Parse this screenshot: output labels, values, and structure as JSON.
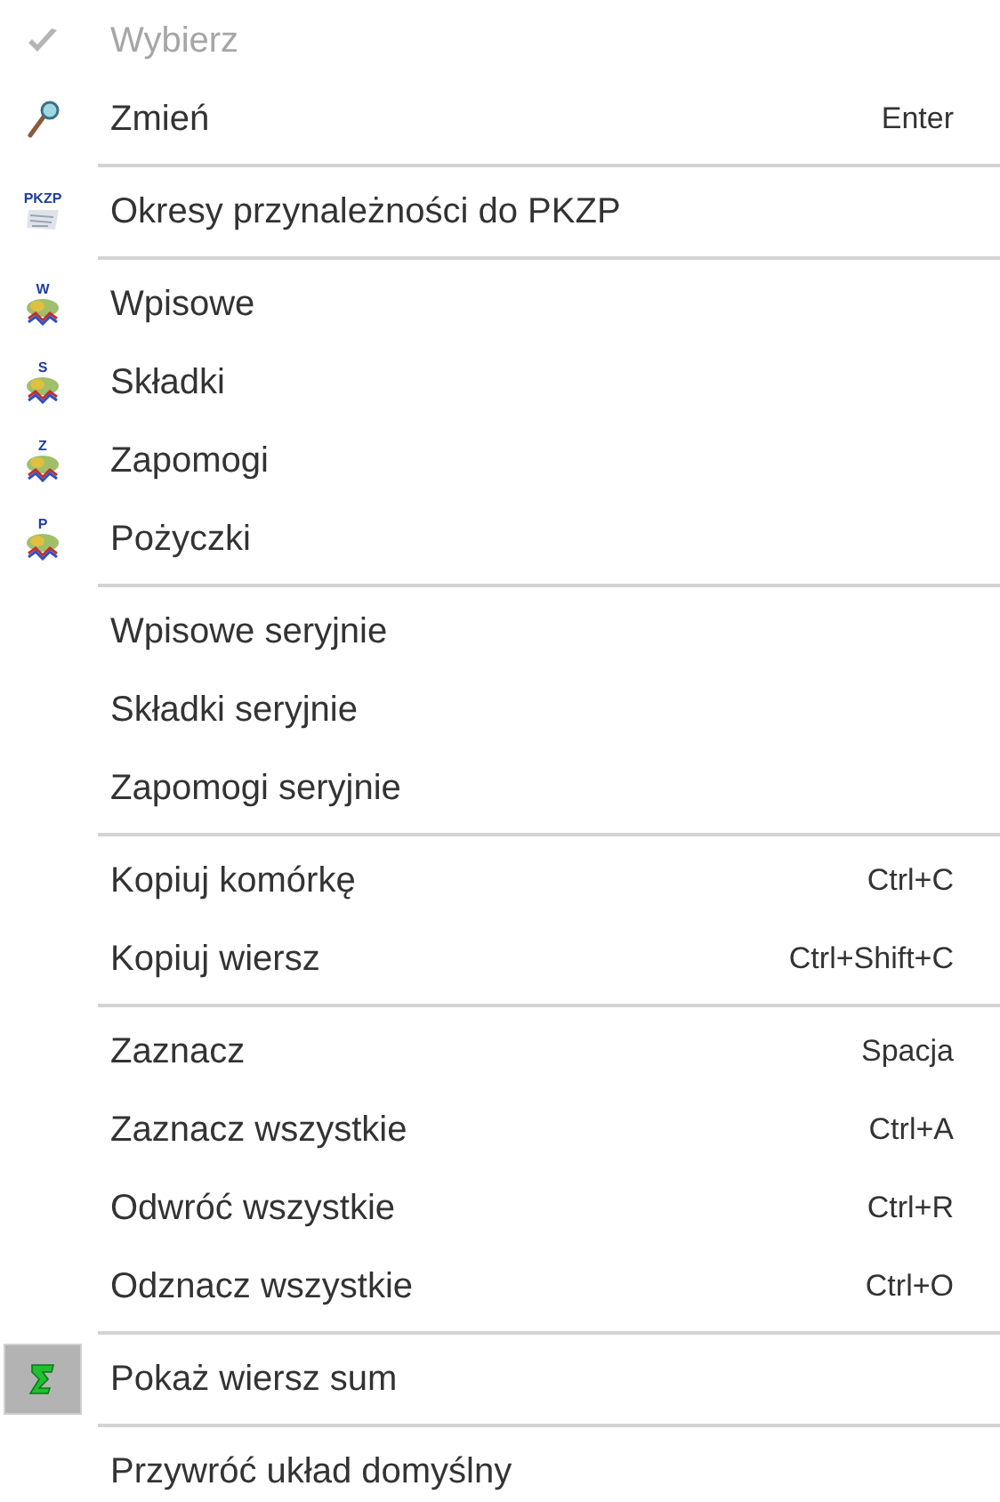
{
  "menu": {
    "groups": [
      [
        {
          "label": "Wybierz",
          "kind": "check",
          "disabled": true
        },
        {
          "label": "Zmień",
          "kind": "magnifier",
          "shortcut": "Enter",
          "disabled": false
        }
      ],
      [
        {
          "label": "Okresy przynależności do PKZP",
          "kind": "pkzp",
          "icon_letter": "PKZP",
          "disabled": false
        }
      ],
      [
        {
          "label": "Wpisowe",
          "kind": "money",
          "icon_letter": "W",
          "disabled": false
        },
        {
          "label": "Składki",
          "kind": "money",
          "icon_letter": "S",
          "disabled": false
        },
        {
          "label": "Zapomogi",
          "kind": "money",
          "icon_letter": "Z",
          "disabled": false
        },
        {
          "label": "Pożyczki",
          "kind": "money",
          "icon_letter": "P",
          "disabled": false
        }
      ],
      [
        {
          "label": "Wpisowe seryjnie",
          "disabled": false
        },
        {
          "label": "Składki seryjnie",
          "disabled": false
        },
        {
          "label": "Zapomogi seryjnie",
          "disabled": false
        }
      ],
      [
        {
          "label": "Kopiuj komórkę",
          "shortcut": "Ctrl+C",
          "disabled": false
        },
        {
          "label": "Kopiuj wiersz",
          "shortcut": "Ctrl+Shift+C",
          "disabled": false
        }
      ],
      [
        {
          "label": "Zaznacz",
          "shortcut": "Spacja",
          "disabled": false
        },
        {
          "label": "Zaznacz wszystkie",
          "shortcut": "Ctrl+A",
          "disabled": false
        },
        {
          "label": "Odwróć wszystkie",
          "shortcut": "Ctrl+R",
          "disabled": false
        },
        {
          "label": "Odznacz wszystkie",
          "shortcut": "Ctrl+O",
          "disabled": false
        }
      ],
      [
        {
          "label": "Pokaż wiersz sum",
          "kind": "sigma",
          "checked": true,
          "disabled": false
        }
      ],
      [
        {
          "label": "Przywróć układ domyślny",
          "disabled": false
        }
      ]
    ]
  }
}
